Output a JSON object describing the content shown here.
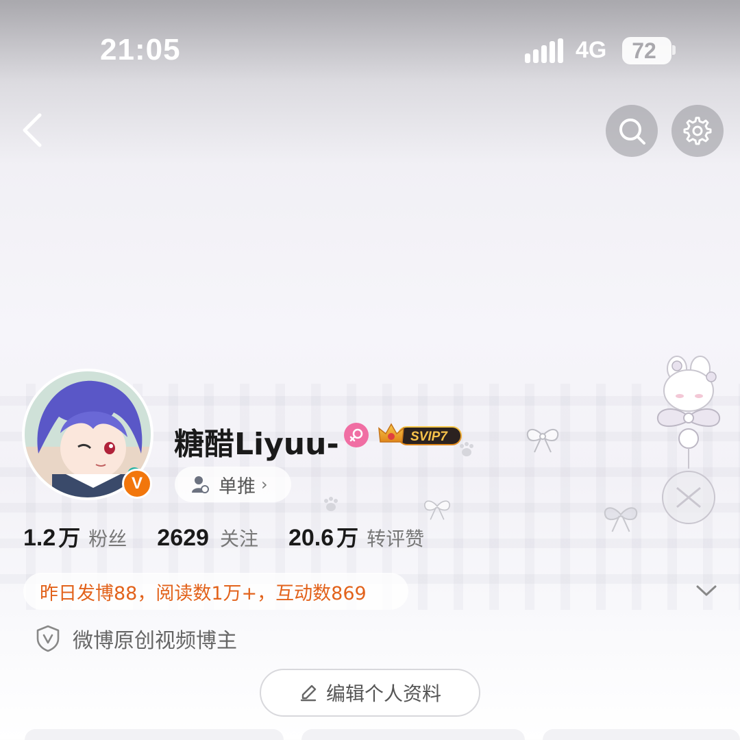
{
  "status_bar": {
    "time": "21:05",
    "network": "4G",
    "battery": "72"
  },
  "nav": {
    "back_icon": "chevron-left-icon",
    "search_icon": "search-icon",
    "settings_icon": "gear-icon"
  },
  "profile": {
    "username": "糖醋Liyuu-",
    "verified_badge": "V",
    "gender_icon": "female-icon",
    "vip_badge": "SVIP7",
    "tag_label": "单推",
    "stats": [
      {
        "number": "1.2",
        "unit": "万",
        "label": "粉丝"
      },
      {
        "number": "2629",
        "unit": "",
        "label": "关注"
      },
      {
        "number": "20.6",
        "unit": "万",
        "label": "转评赞"
      }
    ],
    "daily_summary": "昨日发博88，阅读数1万+，互动数869",
    "certification": "微博原创视频博主",
    "edit_button": "编辑个人资料"
  },
  "colors": {
    "accent_orange": "#e2621b",
    "verified_orange": "#f2760c",
    "gender_pink": "#f06ea3",
    "vip_gold": "#f0a21e"
  }
}
